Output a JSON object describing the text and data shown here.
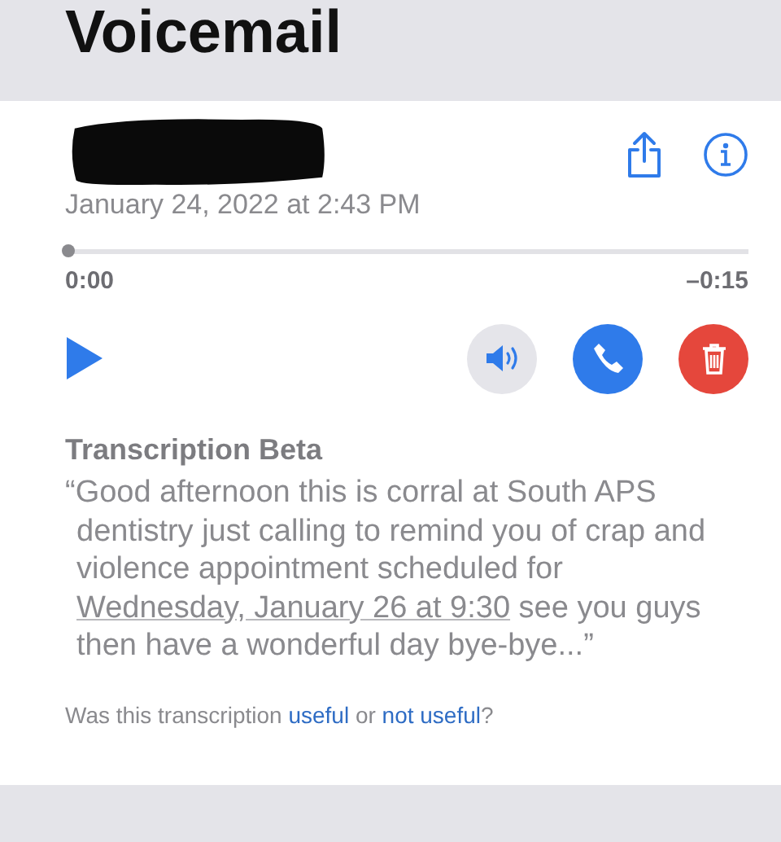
{
  "header": {
    "title": "Voicemail"
  },
  "message": {
    "date": "January 24, 2022 at 2:43 PM"
  },
  "player": {
    "level": 0,
    "elapsed": "0:00",
    "remaining": "–0:15"
  },
  "transcription": {
    "heading": "Transcription Beta",
    "text_before": "“Good afternoon this is corral at South APS dentistry just calling to remind you of crap and violence appointment scheduled for ",
    "date_link": "Wednesday, January 26 at 9:30",
    "text_after": " see you guys then have a wonderful day bye-bye...”"
  },
  "feedback": {
    "prefix": "Was this transcription ",
    "useful_link": "useful",
    "middle": " or ",
    "not_useful_link": "not useful",
    "suffix": "?"
  }
}
